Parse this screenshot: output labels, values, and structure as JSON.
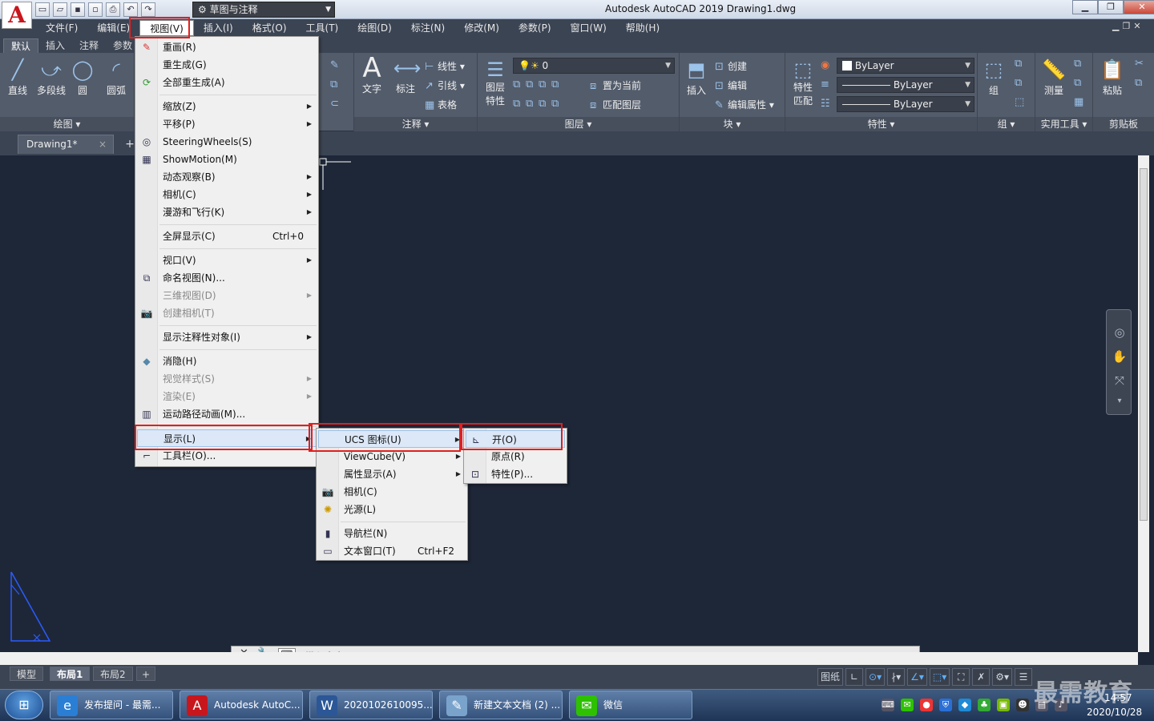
{
  "app": {
    "logo": "A",
    "workspace": "草图与注释",
    "title": "Autodesk AutoCAD 2019    Drawing1.dwg"
  },
  "menubar": {
    "items": [
      "文件(F)",
      "编辑(E)",
      "视图(V)",
      "插入(I)",
      "格式(O)",
      "工具(T)",
      "绘图(D)",
      "标注(N)",
      "修改(M)",
      "参数(P)",
      "窗口(W)",
      "帮助(H)"
    ]
  },
  "ribbon": {
    "tabs": [
      "默认",
      "插入",
      "注释",
      "参数"
    ],
    "draw": {
      "line": "直线",
      "polyline": "多段线",
      "circle": "圆",
      "arc": "圆弧",
      "title": "绘图"
    },
    "annotation": {
      "text": "文字",
      "dimension": "标注",
      "linear": "线性",
      "leader": "引线",
      "table": "表格",
      "title": "注释"
    },
    "layers": {
      "properties_1": "图层",
      "properties_2": "特性",
      "current_layer": "0",
      "set_current": "置为当前",
      "match_layer": "匹配图层",
      "title": "图层"
    },
    "block": {
      "insert": "插入",
      "create": "创建",
      "edit": "编辑",
      "edit_attr": "编辑属性",
      "title": "块"
    },
    "properties": {
      "match_1": "特性",
      "match_2": "匹配",
      "color": "ByLayer",
      "linetype": "ByLayer",
      "lineweight": "ByLayer",
      "title": "特性"
    },
    "group": {
      "label": "组",
      "title": "组"
    },
    "utilities": {
      "measure": "测量",
      "title": "实用工具"
    },
    "clipboard": {
      "paste": "粘贴",
      "title": "剪贴板"
    }
  },
  "doc_tab": {
    "name": "Drawing1*",
    "close": "×",
    "add": "+"
  },
  "command_line": {
    "close": "✕",
    "prompt_icon": "⌨",
    "placeholder": "键入命令"
  },
  "layout_tabs": [
    "模型",
    "布局1",
    "布局2"
  ],
  "status_bar": {
    "paper": "图纸"
  },
  "view_menu": {
    "items": [
      {
        "label": "重画(R)",
        "icon": "brush-icon"
      },
      {
        "label": "重生成(G)"
      },
      {
        "label": "全部重生成(A)",
        "icon": "regen-all-icon"
      },
      {
        "label": "缩放(Z)",
        "submenu": true
      },
      {
        "label": "平移(P)",
        "submenu": true
      },
      {
        "label": "SteeringWheels(S)",
        "icon": "steering-wheel-icon"
      },
      {
        "label": "ShowMotion(M)",
        "icon": "showmotion-icon"
      },
      {
        "label": "动态观察(B)",
        "submenu": true
      },
      {
        "label": "相机(C)",
        "submenu": true
      },
      {
        "label": "漫游和飞行(K)",
        "submenu": true
      },
      {
        "label": "全屏显示(C)",
        "shortcut": "Ctrl+0"
      },
      {
        "label": "视口(V)",
        "submenu": true
      },
      {
        "label": "命名视图(N)...",
        "icon": "named-view-icon"
      },
      {
        "label": "三维视图(D)",
        "submenu": true,
        "disabled": true
      },
      {
        "label": "创建相机(T)",
        "icon": "camera-icon",
        "disabled": true
      },
      {
        "label": "显示注释性对象(I)",
        "submenu": true
      },
      {
        "label": "消隐(H)",
        "icon": "hide-icon"
      },
      {
        "label": "视觉样式(S)",
        "submenu": true,
        "disabled": true
      },
      {
        "label": "渲染(E)",
        "submenu": true,
        "disabled": true
      },
      {
        "label": "运动路径动画(M)...",
        "icon": "film-icon"
      },
      {
        "label": "显示(L)",
        "submenu": true
      },
      {
        "label": "工具栏(O)...",
        "icon": "toolbar-icon"
      }
    ]
  },
  "display_menu": {
    "items": [
      {
        "label": "UCS 图标(U)",
        "submenu": true
      },
      {
        "label": "ViewCube(V)",
        "submenu": true
      },
      {
        "label": "属性显示(A)",
        "submenu": true
      },
      {
        "label": "相机(C)",
        "icon": "camera-icon"
      },
      {
        "label": "光源(L)",
        "icon": "light-icon"
      },
      {
        "label": "导航栏(N)",
        "icon": "navbar-icon"
      },
      {
        "label": "文本窗口(T)",
        "icon": "text-window-icon",
        "shortcut": "Ctrl+F2"
      }
    ]
  },
  "ucs_menu": {
    "items": [
      {
        "label": "开(O)",
        "icon": "ucs-on-icon"
      },
      {
        "label": "原点(R)"
      },
      {
        "label": "特性(P)...",
        "icon": "ucs-properties-icon"
      }
    ]
  },
  "taskbar": {
    "start": "⊞",
    "items": [
      "发布提问 - 最需...",
      "Autodesk AutoC...",
      "2020102610095...",
      "新建文本文档 (2) ...",
      "微信"
    ],
    "time": "14:57",
    "date": "2020/10/28",
    "watermark": "最需教育"
  },
  "colors": {
    "accent_red": "#e02020",
    "menu_bg": "#f0f0f0",
    "canvas": "#1e2738",
    "ribbon": "#535c6b"
  }
}
